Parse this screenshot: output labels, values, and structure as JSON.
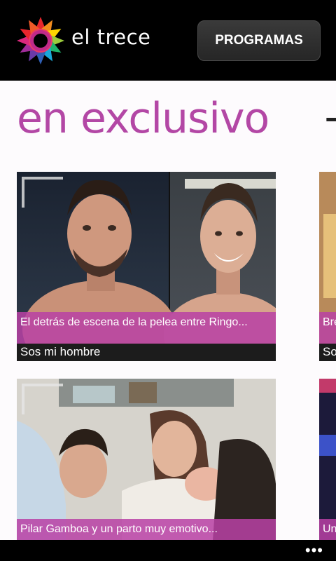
{
  "header": {
    "logo_text": "el trece",
    "programs_button": "PROGRAMAS"
  },
  "section": {
    "title": "en exclusivo",
    "next_title_peek": "+"
  },
  "tiles": [
    {
      "caption": "El detrás de escena de la pelea entre Ringo...",
      "program": "Sos mi hombre"
    },
    {
      "caption": "Pilar Gamboa y un parto muy emotivo...",
      "program": ""
    }
  ],
  "peek_tiles": [
    {
      "caption": "Bre",
      "program": "So"
    },
    {
      "caption": "Un",
      "program": ""
    }
  ],
  "appbar": {
    "more_icon": "more-icon",
    "more_label": "•••"
  },
  "colors": {
    "accent": "#b347a5",
    "caption_bar": "#b941a5",
    "header_bg": "#000000",
    "background": "#fdfbfd"
  }
}
